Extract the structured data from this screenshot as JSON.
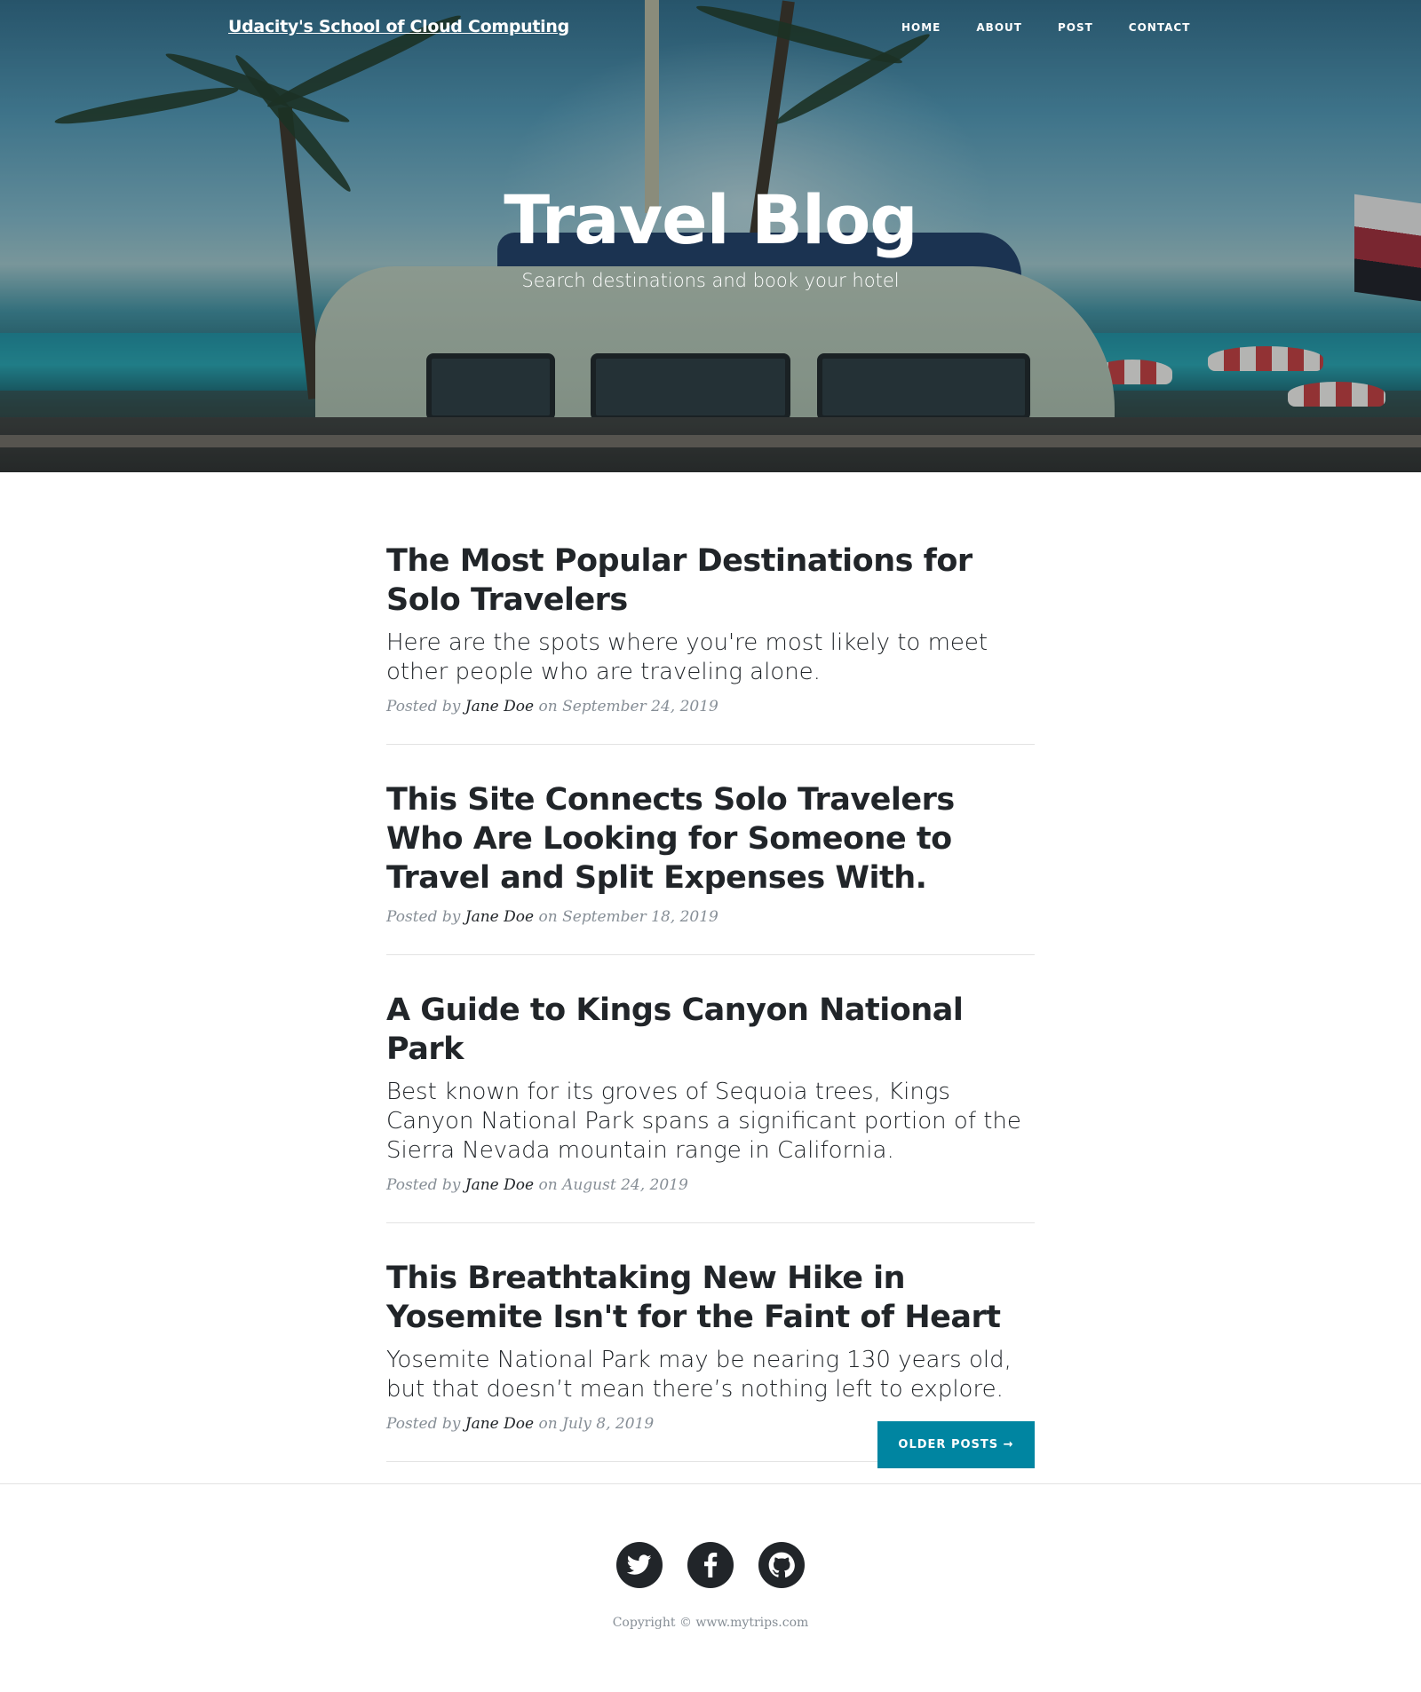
{
  "nav": {
    "brand": "Udacity's School of Cloud Computing",
    "links": [
      "HOME",
      "ABOUT",
      "POST",
      "CONTACT"
    ]
  },
  "hero": {
    "title": "Travel Blog",
    "subtitle": "Search destinations and book your hotel"
  },
  "posts": [
    {
      "title": "The Most Popular Destinations for Solo Travelers",
      "subtitle": "Here are the spots where you're most likely to meet other people who are traveling alone.",
      "meta_prefix": "Posted by",
      "author": "Jane Doe",
      "meta_on": "on",
      "date": "September 24, 2019"
    },
    {
      "title": "This Site Connects Solo Travelers Who Are Looking for Someone to Travel and Split Expenses With.",
      "subtitle": "",
      "meta_prefix": "Posted by",
      "author": "Jane Doe",
      "meta_on": "on",
      "date": "September 18, 2019"
    },
    {
      "title": "A Guide to Kings Canyon National Park",
      "subtitle": "Best known for its groves of Sequoia trees, Kings Canyon National Park spans a significant portion of the Sierra Nevada mountain range in California.",
      "meta_prefix": "Posted by",
      "author": "Jane Doe",
      "meta_on": "on",
      "date": "August 24, 2019"
    },
    {
      "title": "This Breathtaking New Hike in Yosemite Isn't for the Faint of Heart",
      "subtitle": "Yosemite National Park may be nearing 130 years old, but that doesn’t mean there’s nothing left to explore.",
      "meta_prefix": "Posted by",
      "author": "Jane Doe",
      "meta_on": "on",
      "date": "July 8, 2019"
    }
  ],
  "pager": {
    "older_label": "OLDER POSTS →"
  },
  "footer": {
    "social_icons": [
      "twitter-icon",
      "facebook-icon",
      "github-icon"
    ],
    "copyright": "Copyright © www.mytrips.com"
  },
  "colors": {
    "accent": "#0085a1",
    "text": "#212529",
    "muted": "#868e96"
  }
}
